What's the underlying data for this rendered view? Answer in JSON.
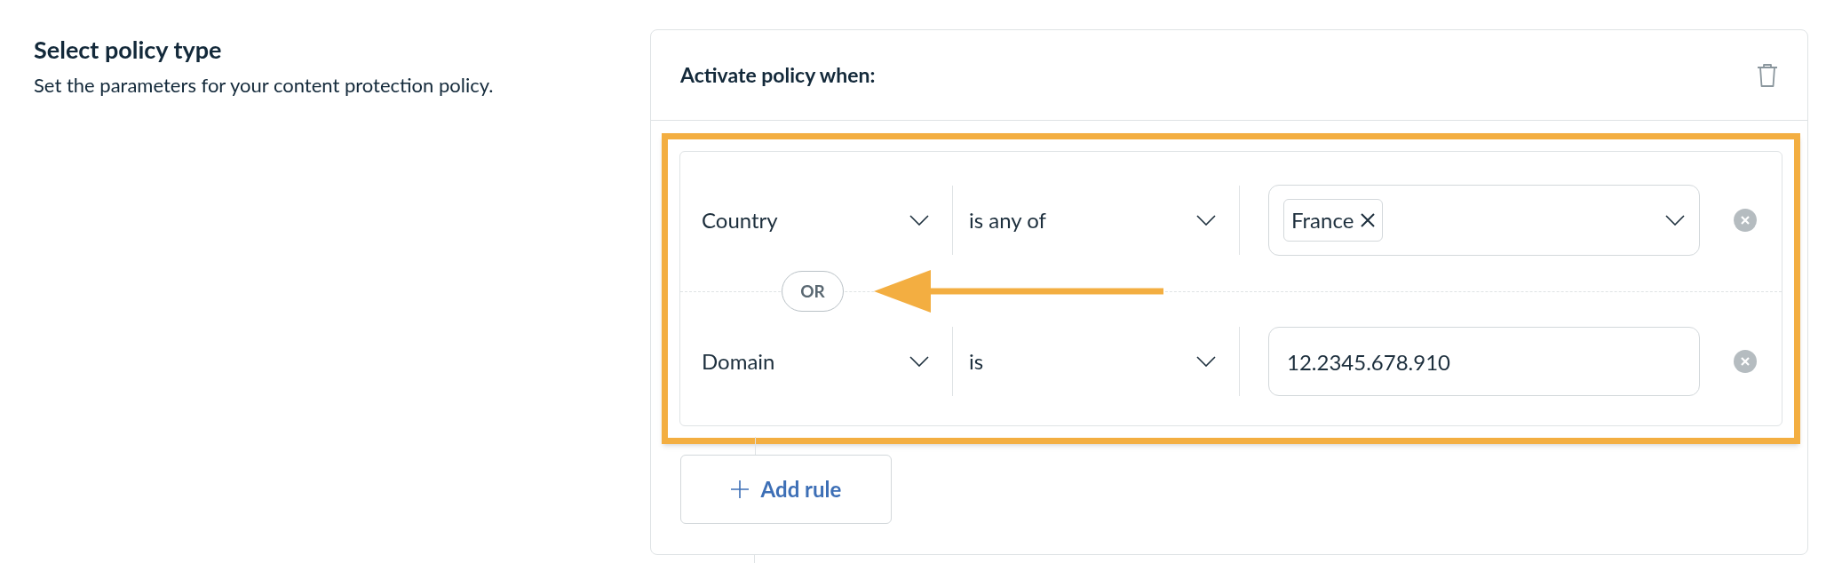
{
  "section": {
    "title": "Select policy type",
    "description": "Set the parameters for your content protection policy."
  },
  "card": {
    "title": "Activate policy when:"
  },
  "rules": [
    {
      "field": "Country",
      "operator": "is any of",
      "kind": "tags",
      "tags": [
        "France"
      ]
    },
    {
      "field": "Domain",
      "operator": "is",
      "kind": "text",
      "value": "12.2345.678.910"
    }
  ],
  "connector": "OR",
  "add_button": "Add rule"
}
